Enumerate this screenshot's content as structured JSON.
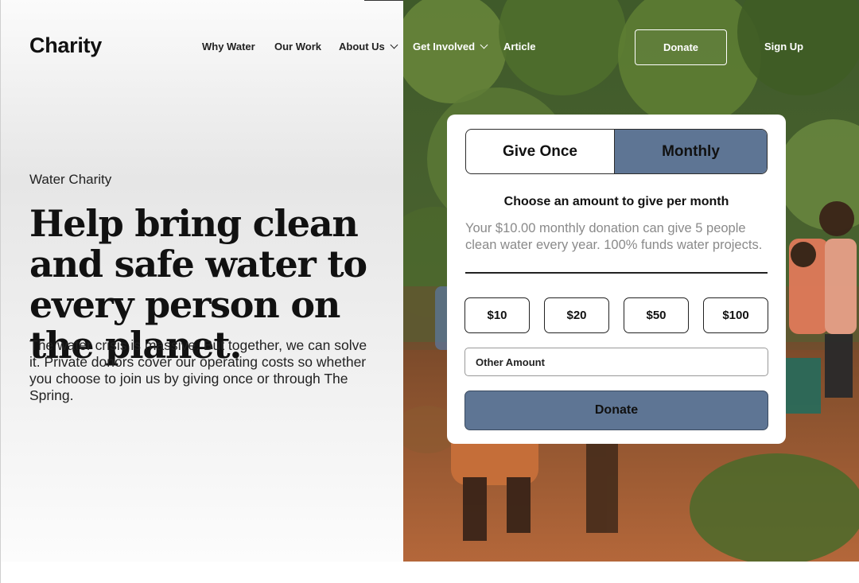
{
  "brand": {
    "logo": "Charity"
  },
  "nav": {
    "items": [
      {
        "label": "Why Water",
        "has_dropdown": false
      },
      {
        "label": "Our Work",
        "has_dropdown": false
      },
      {
        "label": "About Us",
        "has_dropdown": true
      },
      {
        "label": "Get Involved",
        "has_dropdown": true
      },
      {
        "label": "Article",
        "has_dropdown": false
      }
    ],
    "donate": "Donate",
    "signup": "Sign Up"
  },
  "hero": {
    "eyebrow": "Water Charity",
    "headline": "Help bring clean and safe water to every person on the planet.",
    "body": "The water crisis is massive. But together, we can solve it. Private donors cover our operating costs so whether you choose to join us by giving once or through The Spring."
  },
  "donation": {
    "tabs": [
      {
        "label": "Give Once",
        "active": false
      },
      {
        "label": "Monthly",
        "active": true
      }
    ],
    "heading": "Choose an amount to give per month",
    "description": "Your $10.00 monthly donation can give 5 people clean water every year. 100% funds water projects.",
    "amounts": [
      "$10",
      "$20",
      "$50",
      "$100"
    ],
    "other_placeholder": "Other Amount",
    "submit": "Donate"
  },
  "colors": {
    "accent": "#5e7594",
    "text": "#111111",
    "muted": "#8a8a8a"
  }
}
